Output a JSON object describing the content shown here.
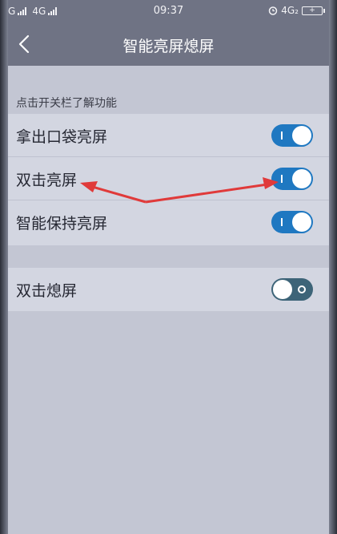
{
  "status": {
    "left": "G",
    "left2": "4G",
    "time": "09:37",
    "network": "4G₂",
    "battery": "+"
  },
  "nav": {
    "title": "智能亮屏熄屏"
  },
  "hint": "点击开关栏了解功能",
  "group1": [
    {
      "label": "拿出口袋亮屏",
      "state": "on"
    },
    {
      "label": "双击亮屏",
      "state": "on"
    },
    {
      "label": "智能保持亮屏",
      "state": "on"
    }
  ],
  "group2": [
    {
      "label": "双击熄屏",
      "state": "off"
    }
  ],
  "colors": {
    "toggle_on": "#1f78c1",
    "toggle_off": "#3d6478",
    "arrow": "#e03a3a"
  }
}
